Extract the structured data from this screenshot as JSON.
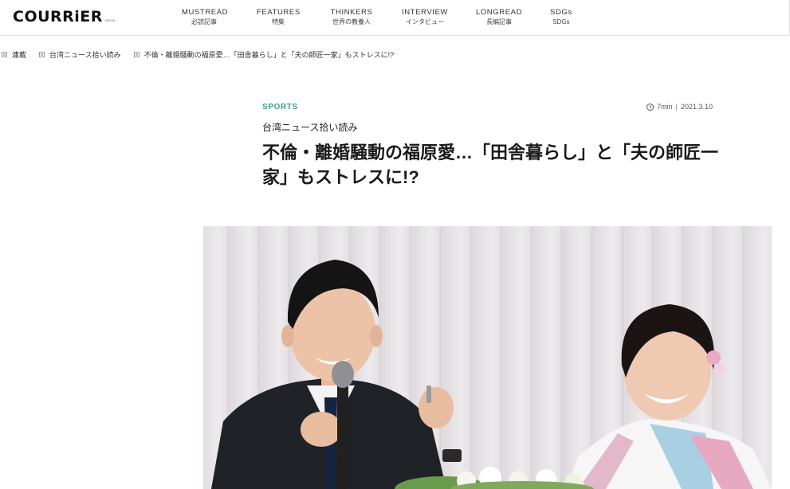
{
  "header": {
    "logo": "COURRiER",
    "logo_sub": "JAPON",
    "nav": [
      {
        "en": "MUSTREAD",
        "ja": "必読記事"
      },
      {
        "en": "FEATURES",
        "ja": "特集"
      },
      {
        "en": "THINKERS",
        "ja": "世界の教養人"
      },
      {
        "en": "INTERVIEW",
        "ja": "インタビュー"
      },
      {
        "en": "LONGREAD",
        "ja": "長編記事"
      },
      {
        "en": "SDGs",
        "ja": "SDGs"
      }
    ]
  },
  "breadcrumb": {
    "items": [
      "連載",
      "台湾ニュース拾い読み",
      "不倫・離婚騒動の福原愛…「田舎暮らし」と「夫の師匠一家」もストレスに!?"
    ]
  },
  "article": {
    "category": "SPORTS",
    "read_time": "7min",
    "date": "2021.3.10",
    "series": "台湾ニュース拾い読み",
    "title": "不倫・離婚騒動の福原愛…「田舎暮らし」と「夫の師匠一家」もストレスに!?"
  },
  "colors": {
    "accent": "#3a9f8b",
    "text": "#1a1a1a",
    "rule": "#e2e2e2"
  },
  "icons": {
    "breadcrumb_separator": "square-icon",
    "read_time": "clock-icon"
  }
}
